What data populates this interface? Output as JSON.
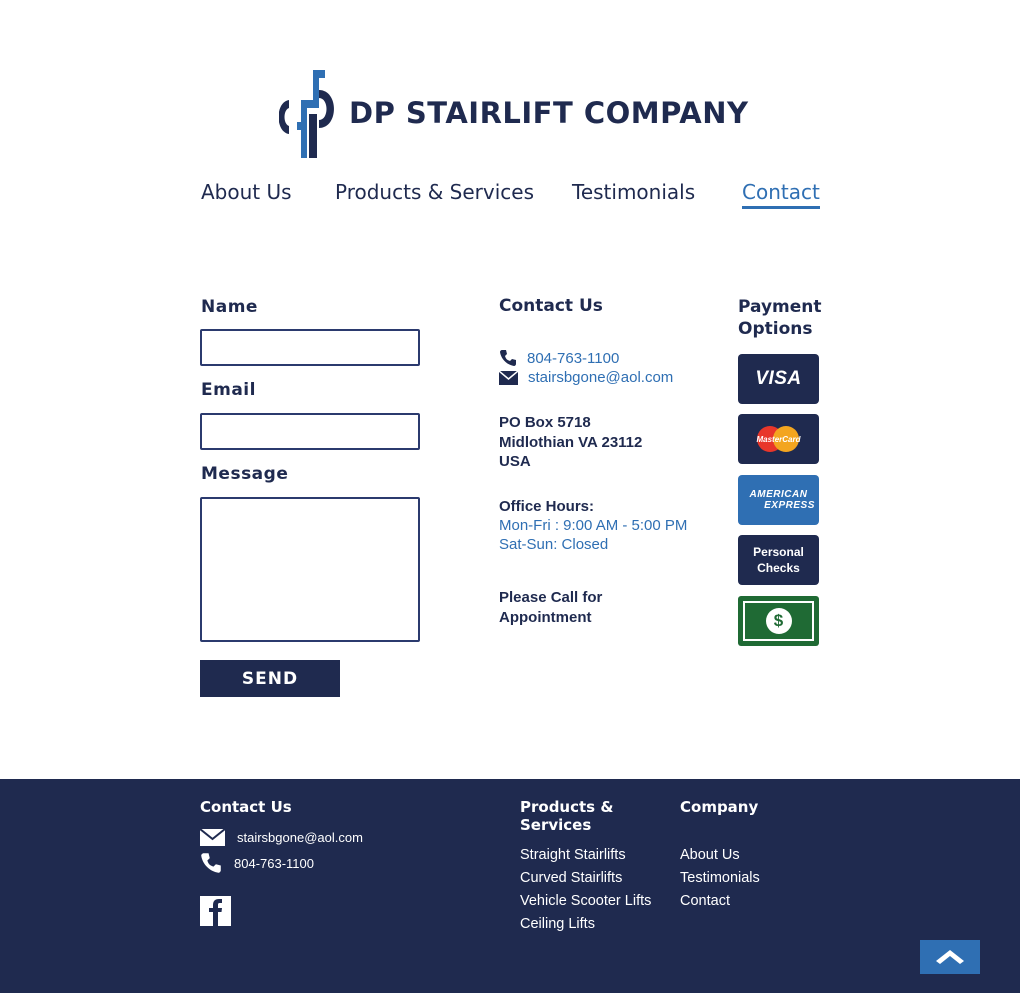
{
  "brand": {
    "name": "DP STAIRLIFT COMPANY",
    "primary_color": "#1f2a4f",
    "accent_color": "#2f6fb3"
  },
  "nav": {
    "items": [
      {
        "label": "About Us",
        "active": false
      },
      {
        "label": "Products & Services",
        "active": false
      },
      {
        "label": "Testimonials",
        "active": false
      },
      {
        "label": "Contact",
        "active": true
      }
    ]
  },
  "form": {
    "name_label": "Name",
    "name_value": "",
    "email_label": "Email",
    "email_value": "",
    "message_label": "Message",
    "message_value": "",
    "send_label": "SEND"
  },
  "contact": {
    "title": "Contact Us",
    "phone": "804-763-1100",
    "email": "stairsbgone@aol.com",
    "address": [
      "PO Box 5718",
      "Midlothian VA 23112",
      "USA"
    ],
    "hours_title": "Office Hours:",
    "hours": [
      "Mon-Fri : 9:00 AM - 5:00 PM",
      "Sat-Sun: Closed"
    ],
    "appointment": [
      "Please Call for",
      "Appointment"
    ]
  },
  "payment": {
    "title": [
      "Payment",
      "Options"
    ],
    "cards": [
      {
        "name": "visa",
        "label": "VISA",
        "icon": "visa-icon"
      },
      {
        "name": "mastercard",
        "label": "MasterCard",
        "icon": "mastercard-icon"
      },
      {
        "name": "amex",
        "label_1": "AMERICAN",
        "label_2": "EXPRESS",
        "icon": "amex-icon"
      },
      {
        "name": "personal-checks",
        "label_1": "Personal",
        "label_2": "Checks",
        "icon": "checks-icon"
      },
      {
        "name": "cash",
        "label": "$",
        "icon": "cash-icon"
      }
    ]
  },
  "footer": {
    "contact_title": "Contact Us",
    "email": "stairsbgone@aol.com",
    "phone": "804-763-1100",
    "products_title": [
      "Products &",
      "Services"
    ],
    "products": [
      "Straight Stairlifts",
      "Curved Stairlifts",
      "Vehicle Scooter Lifts",
      "Ceiling Lifts"
    ],
    "company_title": "Company",
    "company": [
      "About Us",
      "Testimonials",
      "Contact"
    ],
    "social_icon": "facebook-icon",
    "back_to_top_icon": "chevron-up-icon"
  }
}
